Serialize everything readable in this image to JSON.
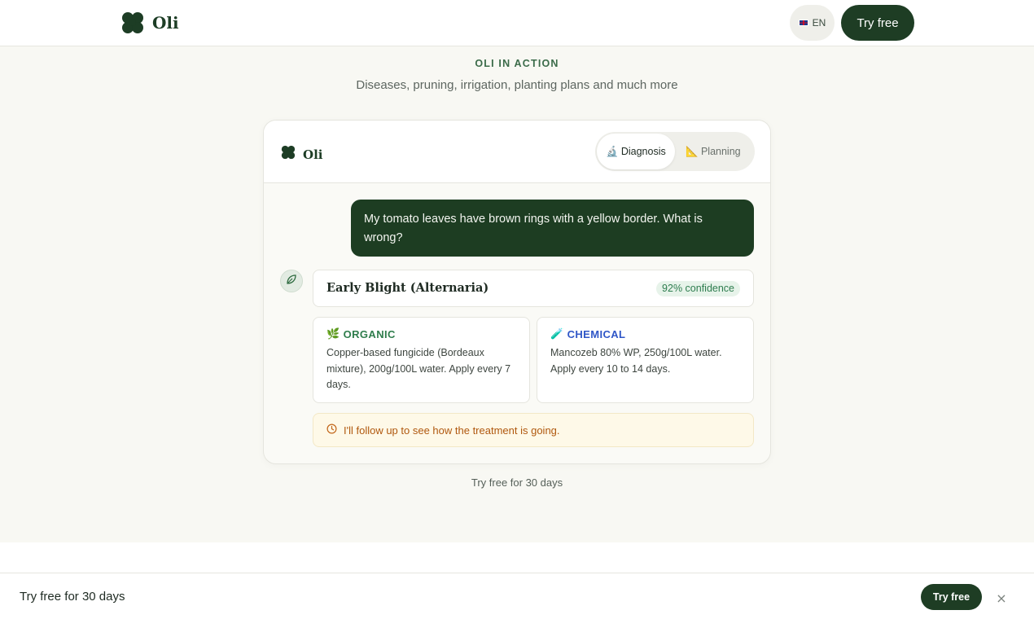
{
  "nav": {
    "brand": "Oli",
    "language": "EN",
    "cta": "Try free"
  },
  "section": {
    "eyebrow": "OLI IN ACTION",
    "subtitle": "Diseases, pruning, irrigation, planting plans and much more"
  },
  "demo": {
    "brand": "Oli",
    "tabs": [
      {
        "icon": "microscope-icon",
        "label": "Diagnosis",
        "active": true
      },
      {
        "icon": "ruler-icon",
        "label": "Planning",
        "active": false
      }
    ],
    "user_message": "My tomato leaves have brown rings with a yellow border. What is wrong?",
    "diagnosis": {
      "title": "Early Blight (Alternaria)",
      "confidence": "92% confidence"
    },
    "treatments": [
      {
        "icon": "herb-icon",
        "label": "ORGANIC",
        "text": "Copper-based fungicide (Bordeaux mixture), 200g/100L water. Apply every 7 days."
      },
      {
        "icon": "test-tube-icon",
        "label": "CHEMICAL",
        "text": "Mancozeb 80% WP, 250g/100L water. Apply every 10 to 14 days."
      }
    ],
    "followup": "I'll follow up to see how the treatment is going."
  },
  "card_footer": "Try free for 30 days",
  "sticky": {
    "text": "Try free for 30 days",
    "button": "Try free",
    "close": "×"
  },
  "colors": {
    "brand_green": "#1e3d24",
    "organic": "#2f7d4c",
    "chemical": "#2f56c7",
    "followup_text": "#b0580e"
  }
}
